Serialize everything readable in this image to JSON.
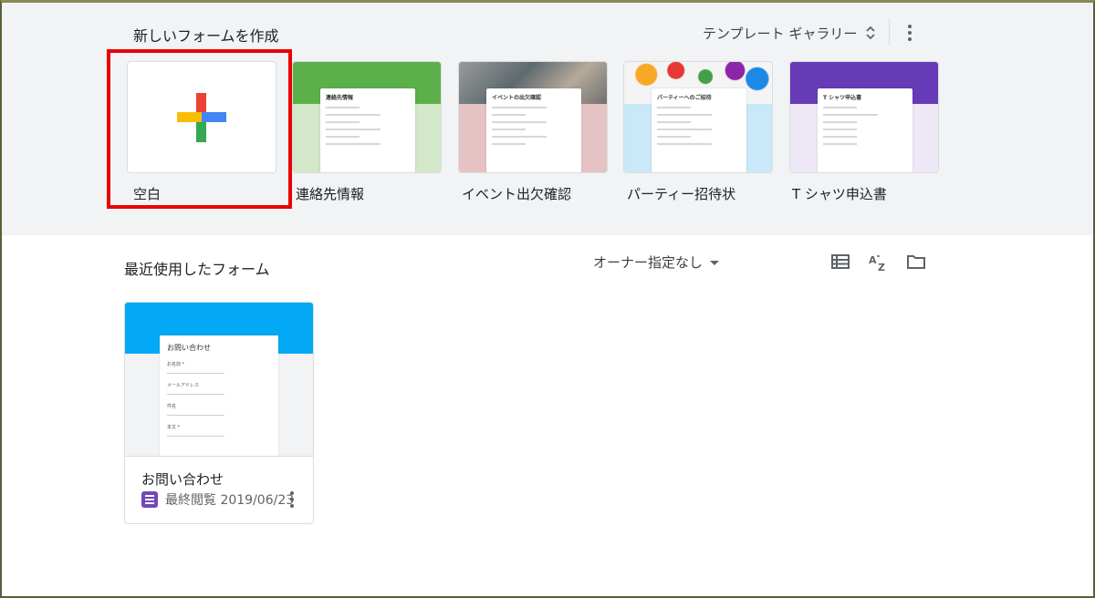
{
  "create_section": {
    "title": "新しいフォームを作成",
    "gallery_label": "テンプレート ギャラリー",
    "more_icon": "more-vert-icon"
  },
  "templates": [
    {
      "label": "空白",
      "kind": "blank"
    },
    {
      "label": "連絡先情報",
      "thumb_title": "連絡先情報",
      "color": "#d2e8c9",
      "header": "#5bb04a"
    },
    {
      "label": "イベント出欠確認",
      "thumb_title": "イベントの出欠確認",
      "color": "#e5c3c5",
      "header": "#7a7a7a"
    },
    {
      "label": "パーティー招待状",
      "thumb_title": "パーティーへのご招待",
      "color": "#c9e8f8",
      "header": "#f6b3b0"
    },
    {
      "label": "T シャツ申込書",
      "thumb_title": "T シャツ申込書",
      "color": "#ede7f6",
      "header": "#673ab7"
    }
  ],
  "recent": {
    "title": "最近使用したフォーム",
    "owner_filter": "オーナー指定なし",
    "tools": [
      "list-view-icon",
      "sort-az-icon",
      "folder-icon"
    ]
  },
  "recent_forms": [
    {
      "name": "お問い合わせ",
      "meta": "最終閲覧 2019/06/23",
      "thumb_title": "お問い合わせ",
      "fields": [
        "お名前 *",
        "メールアドレス",
        "件名",
        "本文 *"
      ]
    }
  ],
  "colors": {
    "highlight": "#ea0000",
    "band": "#f1f3f4",
    "card_header": "#03a9f4",
    "forms_icon": "#7248b9"
  }
}
